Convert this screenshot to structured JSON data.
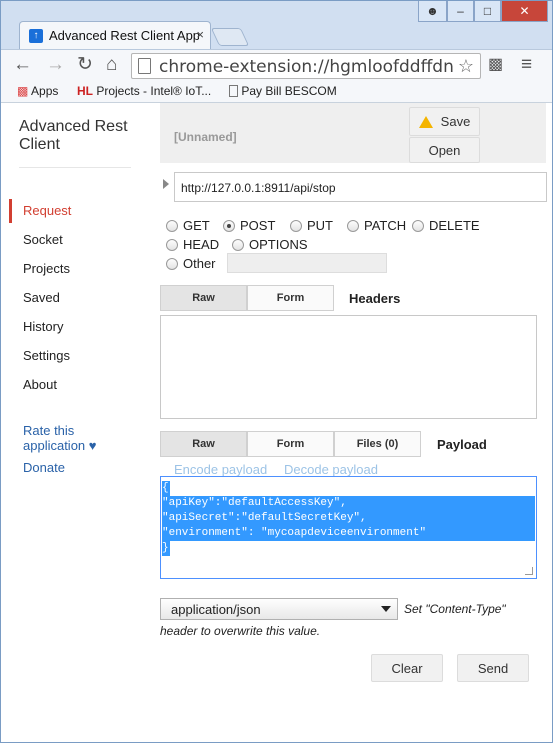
{
  "browser": {
    "tab_title": "Advanced Rest Client App",
    "tab_close": "×",
    "url": "chrome-extension://hgmloofddffdnphfgcel",
    "window_user_icon": "user-icon",
    "bookmarks": [
      {
        "label": "Apps",
        "icon": "apps-grid-icon"
      },
      {
        "label": "Projects - Intel® IoT...",
        "icon": "hl-logo-icon"
      },
      {
        "label": "Pay Bill BESCOM",
        "icon": "page-icon"
      }
    ]
  },
  "sidebar": {
    "app_title": "Advanced Rest Client",
    "items": [
      {
        "label": "Request",
        "active": true
      },
      {
        "label": "Socket"
      },
      {
        "label": "Projects"
      },
      {
        "label": "Saved"
      },
      {
        "label": "History"
      },
      {
        "label": "Settings"
      },
      {
        "label": "About"
      }
    ],
    "rate_label": "Rate this application ♥",
    "donate_label": "Donate"
  },
  "request": {
    "name": "[Unnamed]",
    "save_label": "Save",
    "open_label": "Open",
    "url": "http://127.0.0.1:8911/api/stop",
    "methods": [
      "GET",
      "POST",
      "PUT",
      "PATCH",
      "DELETE",
      "HEAD",
      "OPTIONS",
      "Other"
    ],
    "selected_method": "POST",
    "other_value": ""
  },
  "headers": {
    "tabs": [
      "Raw",
      "Form"
    ],
    "active_tab": "Raw",
    "label": "Headers",
    "value": ""
  },
  "payload": {
    "tabs": [
      "Raw",
      "Form",
      "Files (0)"
    ],
    "active_tab": "Raw",
    "label": "Payload",
    "encode_label": "Encode payload",
    "decode_label": "Decode payload",
    "lines": [
      "{",
      "\"apiKey\":\"defaultAccessKey\",",
      "\"apiSecret\":\"defaultSecretKey\",",
      "\"environment\": \"mycoapdeviceenvironment\"",
      "}"
    ]
  },
  "content_type": {
    "selected": "application/json",
    "note_line1": "Set \"Content-Type\"",
    "note_line2": "header to overwrite this value."
  },
  "actions": {
    "clear_label": "Clear",
    "send_label": "Send"
  },
  "colors": {
    "active_nav": "#d23f31",
    "link": "#2a62a8",
    "selection": "#3399ff"
  }
}
